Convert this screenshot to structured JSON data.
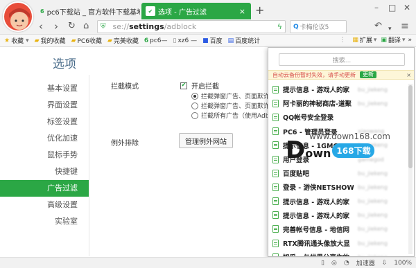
{
  "tabs": [
    {
      "favicon": "6",
      "title": "pc6下载站 _ 官方软件下载基地_",
      "close": "×"
    },
    {
      "favicon": "✔",
      "title": "选项 - 广告过滤",
      "close": "×"
    }
  ],
  "new_tab": "+",
  "window_controls": [
    "–",
    "□",
    "✕"
  ],
  "nav": {
    "back": "‹",
    "forward": "›",
    "reload": "↻",
    "home": "⌂",
    "url_scheme": "se://",
    "url_host": "settings",
    "url_path": "/adblock",
    "search_placeholder": "卡梅伦议5",
    "undo": "↶",
    "menu": "≡"
  },
  "bookmarks_bar": {
    "items": [
      {
        "label": "收藏",
        "icon": "star-icon"
      },
      {
        "label": "我的收藏",
        "icon": "folder-icon"
      },
      {
        "label": "PC6收藏",
        "icon": "folder-icon"
      },
      {
        "label": "完美收藏",
        "icon": "folder-icon"
      },
      {
        "label": "pc6—",
        "icon": "pc6-icon"
      },
      {
        "label": "xz6 —",
        "icon": "doc-icon"
      },
      {
        "label": "百度",
        "icon": "baidu-icon"
      },
      {
        "label": "百度统计",
        "icon": "chart-icon"
      }
    ],
    "right": {
      "extend": "扩展",
      "translate": "翻译",
      "more": "»"
    }
  },
  "page": {
    "title": "选项",
    "sidebar": [
      "基本设置",
      "界面设置",
      "标签设置",
      "优化加速",
      "鼠标手势",
      "快捷键",
      "广告过滤",
      "高级设置",
      "实验室"
    ],
    "active_index": 6,
    "block_mode_label": "拦截模式",
    "enable_label": "开启拦截",
    "options": [
      "拦截弹窗广告、页面欺诈",
      "拦截弹窗广告、页面欺诈",
      "拦截所有广告（使用Adb"
    ],
    "selected_option": 0,
    "exclude_label": "例外排除",
    "manage_button": "管理例外网站"
  },
  "popup": {
    "search_placeholder": "搜索...",
    "sync_warning": "自动云备份暂时失效，请手动更新",
    "sync_button": "更新",
    "sync_close": "×",
    "bookmarks": [
      {
        "title": "提示信息 - 游戏人的家",
        "user": "bu_jiekeng"
      },
      {
        "title": "阿卡丽的神秘商店-道聚",
        "user": "bu_jiekeng"
      },
      {
        "title": "QQ帐号安全登录",
        "user": ""
      },
      {
        "title": "PC6 - 管理员登录",
        "user": "xiaowang"
      },
      {
        "title": "提示信息 - 1GMGAME",
        "user": "bu_jiekeng"
      },
      {
        "title": "用户登录",
        "user": "gamegod"
      },
      {
        "title": "百度贴吧",
        "user": "bu_jiekeng"
      },
      {
        "title": "登录 - 游侠NETSHOW",
        "user": "bu_jiekeng"
      },
      {
        "title": "提示信息 - 游戏人的家",
        "user": "bu_jiekeng"
      },
      {
        "title": "提示信息 - 游戏人的家",
        "user": "bu_jiekeng"
      },
      {
        "title": "完善帐号信息 - 地信网",
        "user": "bu_jiekeng"
      },
      {
        "title": "RTX腾讯通头像放大显",
        "user": "bu_jiekeng"
      },
      {
        "title": "知乎 - 与世界分享你的",
        "user": "bu_jiekeng"
      }
    ]
  },
  "watermark": {
    "url": "www.down168.com",
    "d": "D",
    "own": "own",
    "badge": "168下载"
  },
  "statusbar": {
    "accelerator": "加速器",
    "speed": "100%"
  }
}
